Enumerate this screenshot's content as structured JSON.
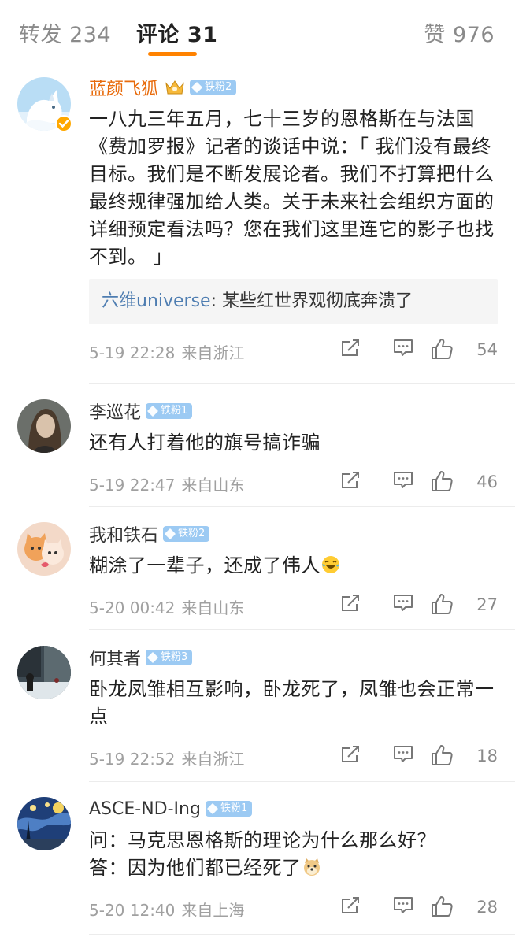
{
  "tabs": {
    "repost": "转发 234",
    "comments": "评论 31",
    "likes": "赞 976"
  },
  "colors": {
    "accent": "#ff8200",
    "highlight_name": "#e86b0c",
    "badge_bg": "#9ccaf3",
    "reply_name": "#4e7db1",
    "meta_text": "#a0a0a0"
  },
  "comments": [
    {
      "username": "蓝颜飞狐",
      "badge": "铁粉2",
      "crown_icon": "crown-icon",
      "verified_icon": "verified-badge-icon",
      "text": "一八九三年五月，七十三岁的恩格斯在与法国《费加罗报》记者的谈话中说：「 我们没有最终目标。我们是不断发展论者。我们不打算把什么最终规律强加给人类。关于未来社会组织方面的详细预定看法吗？您在我们这里连它的影子也找不到。 」",
      "reply": {
        "name": "六维universe",
        "text": ": 某些红世界观彻底奔溃了"
      },
      "time": "5-19 22:28",
      "location": "来自浙江",
      "likes": "54"
    },
    {
      "username": "李巡花",
      "badge": "铁粉1",
      "text": "还有人打着他的旗号搞诈骗",
      "time": "5-19 22:47",
      "location": "来自山东",
      "likes": "46"
    },
    {
      "username": "我和铁石",
      "badge": "铁粉2",
      "text": "糊涂了一辈子，还成了伟人",
      "emoji": "laugh-cry-emoji",
      "time": "5-20 00:42",
      "location": "来自山东",
      "likes": "27"
    },
    {
      "username": "何其者",
      "badge": "铁粉3",
      "text": "卧龙凤雏相互影响，卧龙死了，凤雏也会正常一点",
      "time": "5-19 22:52",
      "location": "来自浙江",
      "likes": "18"
    },
    {
      "username": "ASCE-ND-Ing",
      "badge": "铁粉1",
      "text_line1": "问：马克思恩格斯的理论为什么那么好？",
      "text_line2": "答：因为他们都已经死了",
      "emoji": "doge-emoji",
      "time": "5-20 12:40",
      "location": "来自上海",
      "likes": "28"
    }
  ]
}
